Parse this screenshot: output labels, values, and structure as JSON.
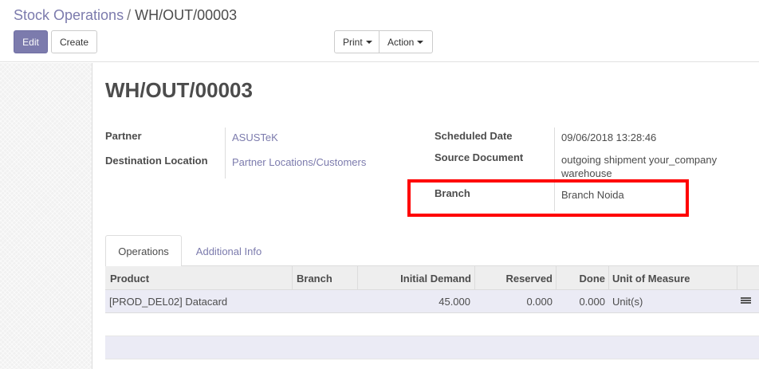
{
  "breadcrumb": {
    "parent": "Stock Operations",
    "separator": "/",
    "current": "WH/OUT/00003"
  },
  "toolbar": {
    "edit_label": "Edit",
    "create_label": "Create",
    "print_label": "Print",
    "action_label": "Action"
  },
  "record": {
    "title": "WH/OUT/00003",
    "partner_label": "Partner",
    "partner_value": "ASUSTeK",
    "destination_label": "Destination Location",
    "destination_value": "Partner Locations/Customers",
    "scheduled_label": "Scheduled Date",
    "scheduled_value": "09/06/2018 13:28:46",
    "source_label": "Source Document",
    "source_value_line1": "outgoing shipment your_company",
    "source_value_line2": "warehouse",
    "branch_label": "Branch",
    "branch_value": "Branch Noida"
  },
  "tabs": [
    {
      "label": "Operations",
      "active": true
    },
    {
      "label": "Additional Info",
      "active": false
    }
  ],
  "table": {
    "columns": [
      "Product",
      "Branch",
      "Initial Demand",
      "Reserved",
      "Done",
      "Unit of Measure"
    ],
    "rows": [
      {
        "product": "[PROD_DEL02] Datacard",
        "branch": "",
        "initial_demand": "45.000",
        "reserved": "0.000",
        "done": "0.000",
        "uom": "Unit(s)"
      }
    ]
  },
  "colors": {
    "accent": "#7c7bad",
    "highlight": "#ff0000"
  },
  "icons": {
    "row_action": "list-icon"
  }
}
